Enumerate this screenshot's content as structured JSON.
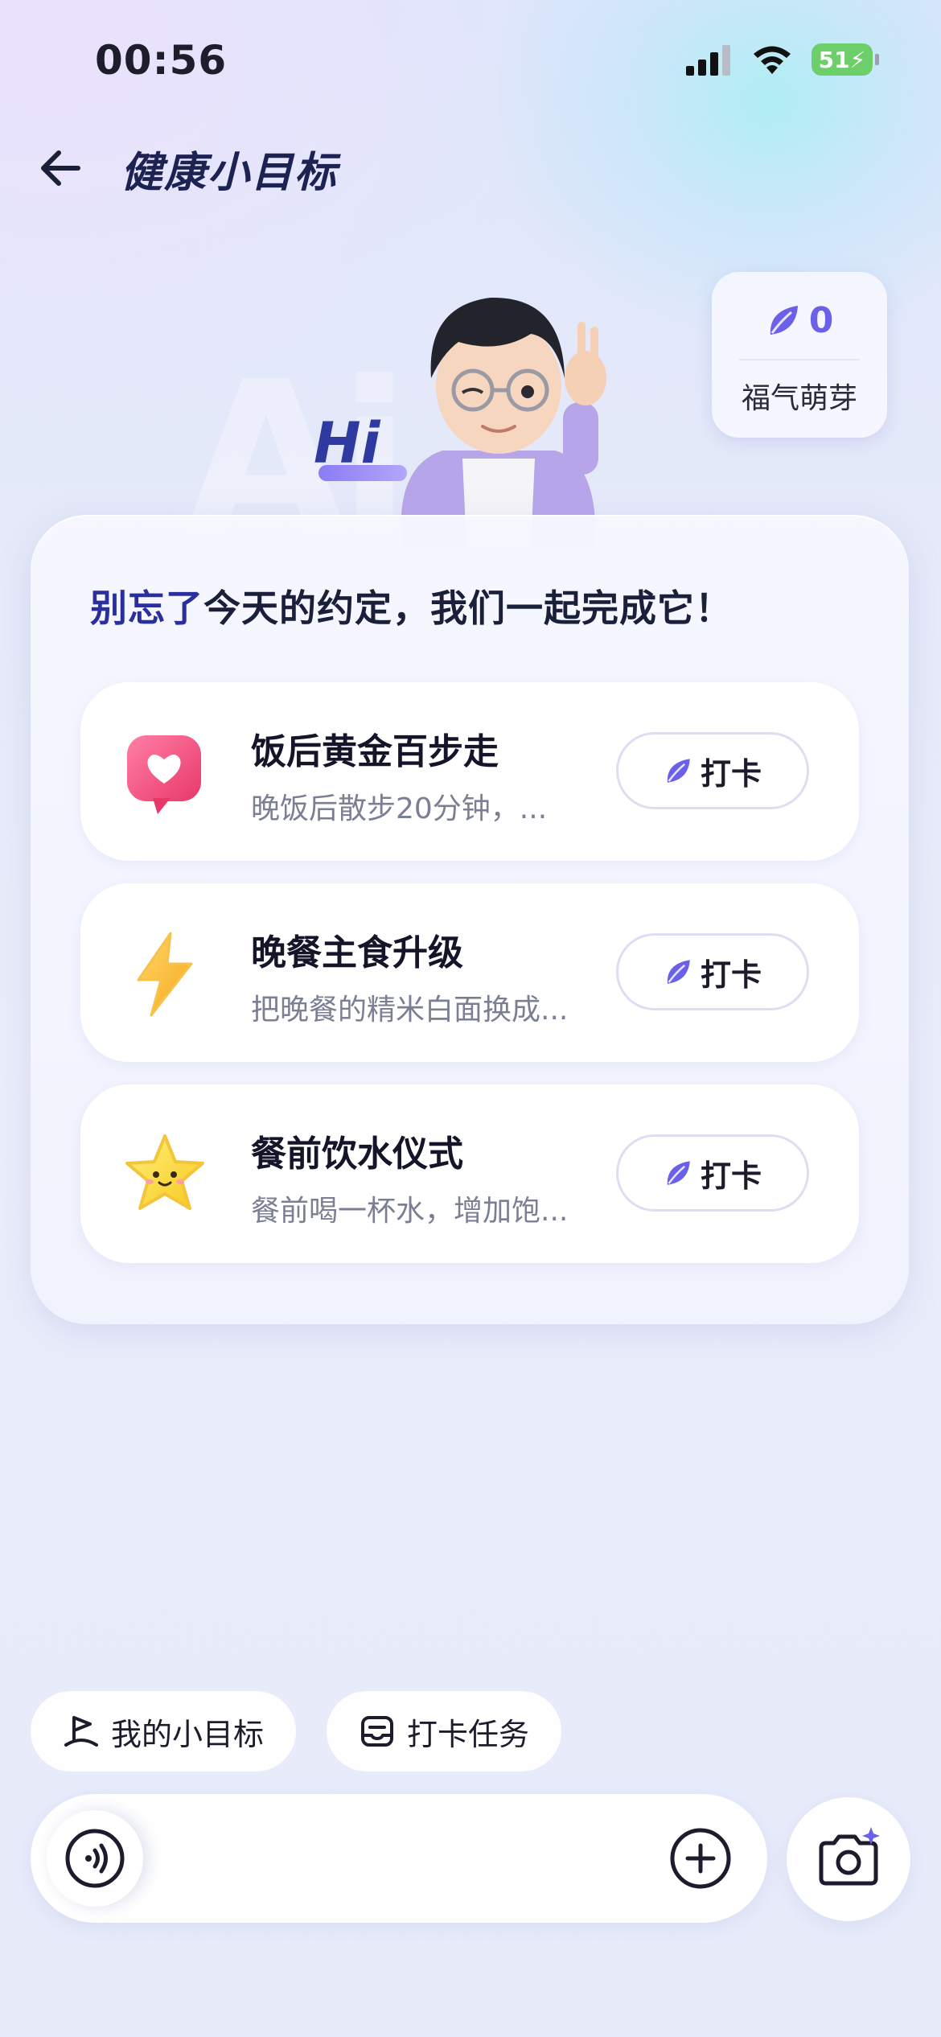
{
  "status_bar": {
    "time": "00:56",
    "battery": "51"
  },
  "header": {
    "title": "健康小目标"
  },
  "hero": {
    "watermark": "Ai",
    "greeting": "Hi"
  },
  "points": {
    "value": "0",
    "label": "福气萌芽"
  },
  "card": {
    "heading_accent": "别忘了",
    "heading_rest": "今天的约定，我们一起完成它！",
    "tasks": [
      {
        "title": "饭后黄金百步走",
        "desc": "晚饭后散步20分钟，...",
        "icon": "heart-bubble-icon",
        "button": "打卡"
      },
      {
        "title": "晚餐主食升级",
        "desc": "把晚餐的精米白面换成...",
        "icon": "lightning-icon",
        "button": "打卡"
      },
      {
        "title": "餐前饮水仪式",
        "desc": "餐前喝一杯水，增加饱...",
        "icon": "smiling-star-icon",
        "button": "打卡"
      }
    ]
  },
  "chips": [
    {
      "label": "我的小目标",
      "icon": "flag-icon"
    },
    {
      "label": "打卡任务",
      "icon": "clipboard-icon"
    }
  ],
  "input_bar": {
    "voice_icon": "voice-icon",
    "add_icon": "plus-circle-icon",
    "camera_icon": "camera-sparkle-icon"
  },
  "colors": {
    "accent": "#6a61e8",
    "heading_accent": "#2a2f9c",
    "battery": "#6ccf6a"
  }
}
